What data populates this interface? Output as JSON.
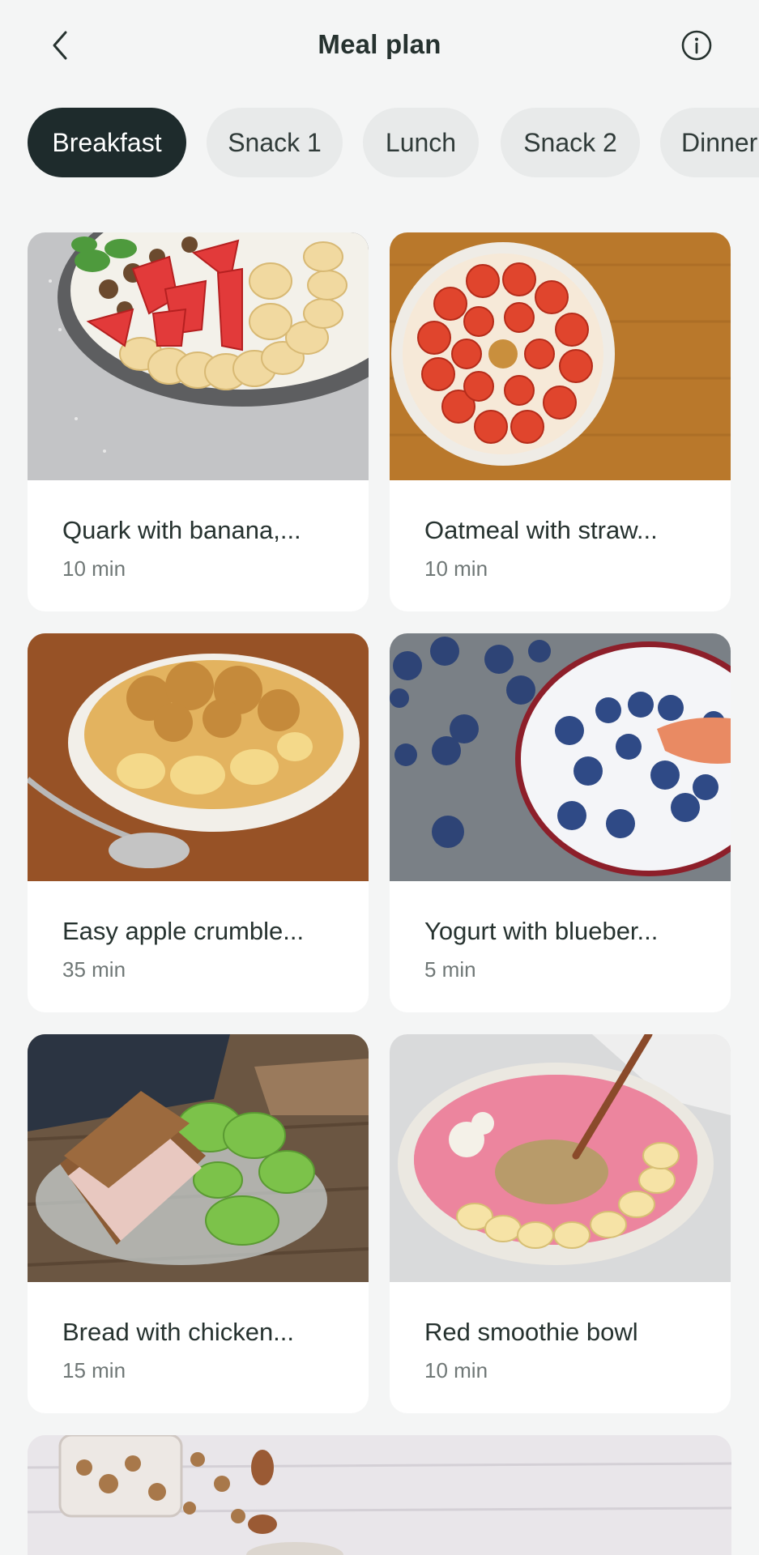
{
  "header": {
    "title": "Meal plan",
    "back_icon": "chevron-left-icon",
    "info_icon": "info-circle-icon"
  },
  "tabs": [
    {
      "label": "Breakfast",
      "active": true
    },
    {
      "label": "Snack 1",
      "active": false
    },
    {
      "label": "Lunch",
      "active": false
    },
    {
      "label": "Snack 2",
      "active": false
    },
    {
      "label": "Dinner",
      "active": false
    }
  ],
  "recipes": [
    {
      "name": "Quark with banana,...",
      "time": "10 min"
    },
    {
      "name": "Oatmeal with straw...",
      "time": "10 min"
    },
    {
      "name": "Easy apple crumble...",
      "time": "35 min"
    },
    {
      "name": "Yogurt with blueber...",
      "time": "5 min"
    },
    {
      "name": "Bread with chicken...",
      "time": "15 min"
    },
    {
      "name": "Red smoothie bowl",
      "time": "10 min"
    }
  ],
  "colors": {
    "accent": "#1e2b2c",
    "background": "#f4f5f5",
    "chip": "#e8eaea"
  }
}
